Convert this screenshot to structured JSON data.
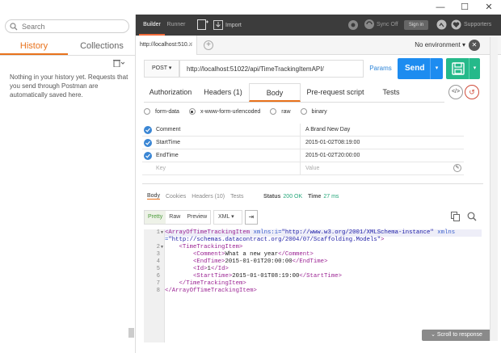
{
  "window": {
    "minimize": "—",
    "maximize": "☐",
    "close": "✕"
  },
  "sidebar": {
    "search_placeholder": "Search",
    "tabs": [
      {
        "label": "History"
      },
      {
        "label": "Collections"
      }
    ],
    "empty_history": "Nothing in your history yet. Requests that you send through Postman are automatically saved here."
  },
  "header": {
    "tabs": [
      {
        "label": "Builder"
      },
      {
        "label": "Runner"
      }
    ],
    "import_label": "Import",
    "sync_label": "Sync Off",
    "signin_label": "Sign in",
    "supporters_label": "Supporters"
  },
  "request_tab": {
    "label": "http://localhost:510...",
    "close": "✕"
  },
  "environment": {
    "selected": "No environment ▾"
  },
  "request": {
    "method": "POST ▾",
    "url": "http://localhost:51022/api/TimeTrackingItemAPI/",
    "params_label": "Params",
    "send_label": "Send",
    "tabs": [
      {
        "label": "Authorization"
      },
      {
        "label": "Headers (1)"
      },
      {
        "label": "Body"
      },
      {
        "label": "Pre-request script"
      },
      {
        "label": "Tests"
      }
    ],
    "code_label": "</>",
    "body_types": [
      {
        "label": "form-data"
      },
      {
        "label": "x-www-form-urlencoded"
      },
      {
        "label": "raw"
      },
      {
        "label": "binary"
      }
    ],
    "params": [
      {
        "key": "Comment",
        "value": "A Brand New Day"
      },
      {
        "key": "StartTime",
        "value": "2015-01-02T08:19:00"
      },
      {
        "key": "EndTime",
        "value": "2015-01-02T20:00:00"
      }
    ],
    "key_placeholder": "Key",
    "value_placeholder": "Value"
  },
  "response": {
    "tabs": [
      {
        "label": "Body"
      },
      {
        "label": "Cookies"
      },
      {
        "label": "Headers (10)"
      },
      {
        "label": "Tests"
      }
    ],
    "status_label": "Status",
    "status_value": "200 OK",
    "time_label": "Time",
    "time_value": "27 ms",
    "formats": [
      {
        "label": "Pretty"
      },
      {
        "label": "Raw"
      },
      {
        "label": "Preview"
      }
    ],
    "language": "XML ▾",
    "code": {
      "line_numbers": [
        "1",
        "2",
        "3",
        "4",
        "5",
        "6",
        "7",
        "8"
      ],
      "l1_open": "<ArrayOfTimeTrackingItem ",
      "l1_attr1": "xmlns:i=",
      "l1_val1": "\"http://www.w3.org/2001/XMLSchema-instance\"",
      "l1_attr2": " xmlns",
      "l1b_eq": "=",
      "l1b_val2": "\"http://schemas.datacontract.org/2004/07/Scaffolding.Models\"",
      "l1b_close": ">",
      "l2": "<TimeTrackingItem>",
      "l3_open": "<Comment>",
      "l3_text": "What a new year",
      "l3_close": "</Comment>",
      "l4_open": "<EndTime>",
      "l4_text": "2015-01-01T20:00:00",
      "l4_close": "</EndTime>",
      "l5_open": "<Id>",
      "l5_text": "1",
      "l5_close": "</Id>",
      "l6_open": "<StartTime>",
      "l6_text": "2015-01-01T08:19:00",
      "l6_close": "</StartTime>",
      "l7": "</TimeTrackingItem>",
      "l8": "</ArrayOfTimeTrackingItem>"
    },
    "scroll_label": "Scroll to response"
  },
  "colors": {
    "accent_orange": "#e8721c",
    "send_blue": "#1d8cf0",
    "save_green": "#25b98a",
    "header_dark": "#3c3c3c",
    "check_blue": "#3a86d4"
  }
}
